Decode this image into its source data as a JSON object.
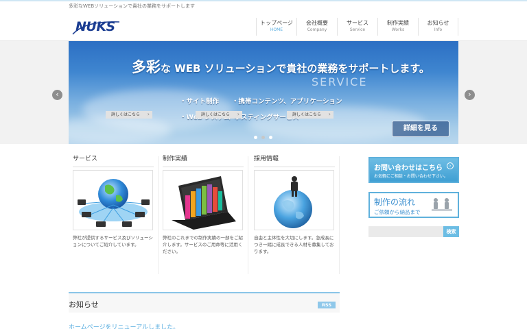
{
  "tagline": "多彩なWEBソリューションで貴社の業務をサポートします",
  "logo": {
    "text": "NUKS",
    "color": "#1b3d92"
  },
  "nav": [
    {
      "jp": "トップページ",
      "en": "HOME"
    },
    {
      "jp": "会社概要",
      "en": "Company"
    },
    {
      "jp": "サービス",
      "en": "Service"
    },
    {
      "jp": "制作実績",
      "en": "Works"
    },
    {
      "jp": "お知らせ",
      "en": "Info"
    }
  ],
  "hero": {
    "headline_big": "多彩",
    "headline_rest": "な WEB ソリューションで貴社の業務をサポートします。",
    "watermark": "SERVICE",
    "bullets": [
      "・サイト制作",
      "・携帯コンテンツ、アプリケーション",
      "・Web システム",
      "・ホスティングサービス"
    ],
    "cta": "詳細を見る",
    "prev_icon": "chevron-left-icon",
    "next_icon": "chevron-right-icon",
    "prev_glyph": "‹",
    "next_glyph": "›",
    "slide_count": 3,
    "active_slide": 2
  },
  "columns": [
    {
      "title": "サービス",
      "text": "弊社が提供するサービス及びソリューションについてご紹介しています。",
      "button": "詳しくはこちら"
    },
    {
      "title": "制作実績",
      "text": "弊社のこれまでの制作実績の一部をご紹介します。サービスのご用命等に活用ください。",
      "button": "詳しくはこちら"
    },
    {
      "title": "採用情報",
      "text": "自由と主体性を大切にします。急成長につき一緒に成長できる人材を募集しております。",
      "button": "詳しくはこちら"
    }
  ],
  "sidebar": {
    "contact_title": "お問い合わせはこちら",
    "contact_sub": "お気軽にご相談・お問い合わせ下さい。",
    "contact_glyph": "›",
    "flow_title": "制作の流れ",
    "flow_sub": "ご依頼から納品まで",
    "search_placeholder": "",
    "search_button": "検索"
  },
  "news": {
    "title": "お知らせ",
    "rss": "RSS",
    "first_item": "ホームページをリニューアルしました。"
  },
  "colors": {
    "accent": "#5aaee0",
    "brand": "#1b3d92",
    "sky": "#3f86d0"
  }
}
